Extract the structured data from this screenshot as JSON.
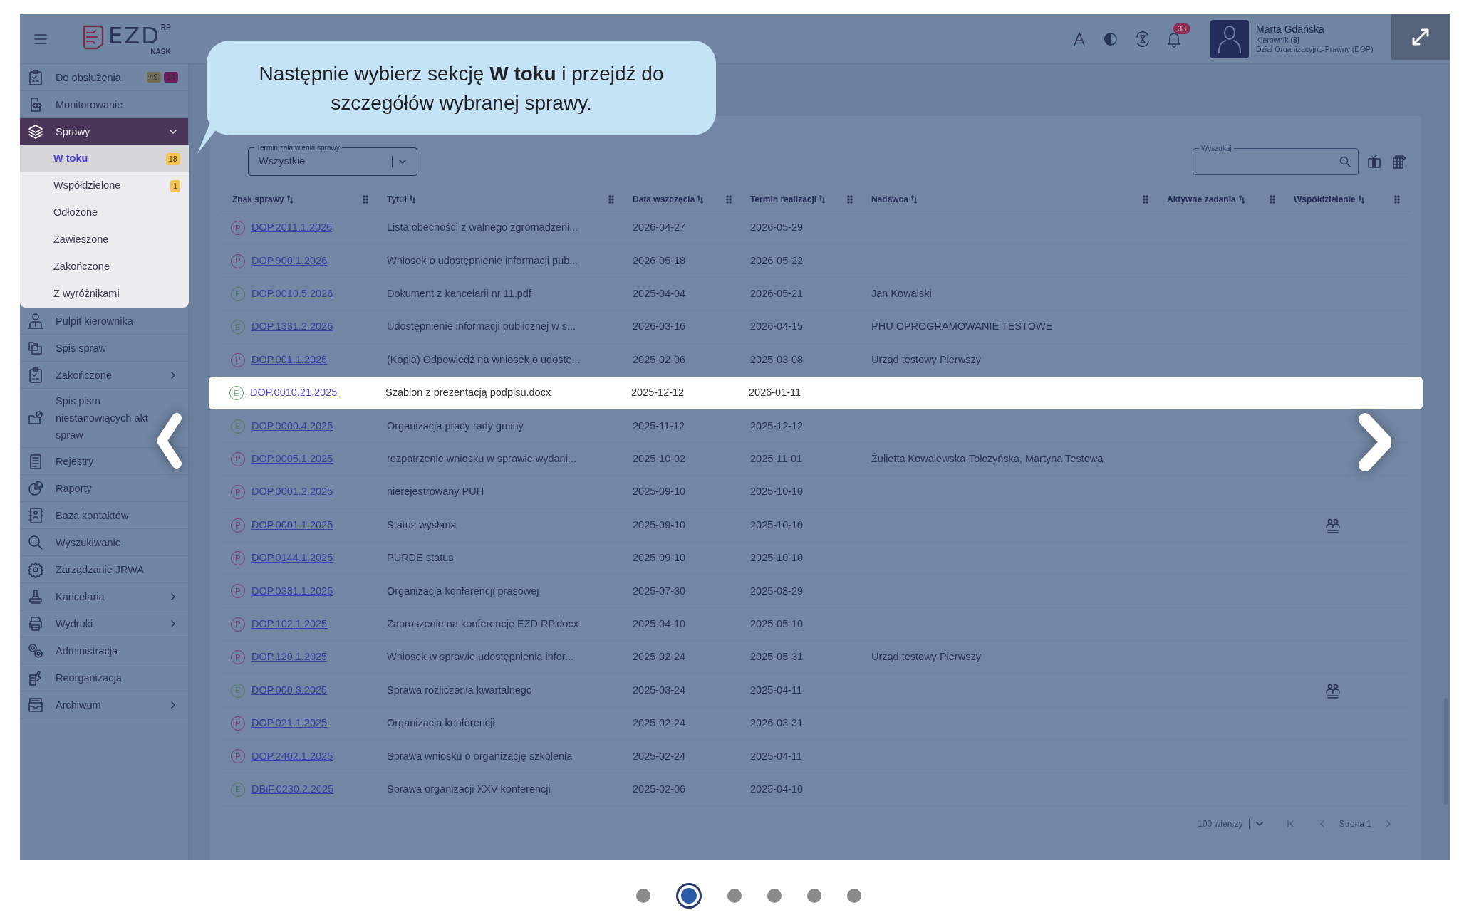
{
  "header": {
    "logo": {
      "text": "EZD",
      "sup": "RP",
      "sub": "NASK"
    },
    "notification_count": "33",
    "user": {
      "name": "Marta Gdańska",
      "role": "Kierownik",
      "role_count": "(3)",
      "department": "Dział Organizacyjno-Prawny (DOP)"
    }
  },
  "sidebar": {
    "items": [
      {
        "label": "Do obsłużenia",
        "badges": [
          {
            "text": "49",
            "color": "#6f6b4f"
          },
          {
            "text": "14",
            "color": "#6b2160"
          }
        ]
      },
      {
        "label": "Monitorowanie"
      },
      {
        "label": "Sprawy",
        "expanded": true,
        "children": [
          {
            "label": "W toku",
            "selected": true,
            "badge": "18"
          },
          {
            "label": "Współdzielone",
            "selected": false,
            "badge": "1"
          },
          {
            "label": "Odłożone",
            "selected": false
          },
          {
            "label": "Zawieszone",
            "selected": false
          },
          {
            "label": "Zakończone",
            "selected": false
          },
          {
            "label": "Z wyróżnikami",
            "selected": false
          }
        ]
      },
      {
        "label": "Pulpit kierownika"
      },
      {
        "label": "Spis spraw"
      },
      {
        "label": "Zakończone",
        "expanded": false
      },
      {
        "label": "Spis pism niestanowiących akt spraw"
      },
      {
        "label": "Rejestry"
      },
      {
        "label": "Raporty"
      },
      {
        "label": "Baza kontaktów"
      },
      {
        "label": "Wyszukiwanie"
      },
      {
        "label": "Zarządzanie JRWA"
      },
      {
        "label": "Kancelaria",
        "expanded": false
      },
      {
        "label": "Wydruki",
        "expanded": false
      },
      {
        "label": "Administracja"
      },
      {
        "label": "Reorganizacja"
      },
      {
        "label": "Archiwum",
        "expanded": false
      }
    ]
  },
  "tutorial": {
    "message": "Następnie wybierz sekcję **W toku** i przejdź do szczegółów wybranej sprawy.",
    "slides": [
      {
        "selected": false
      },
      {
        "selected": true
      },
      {
        "selected": false
      },
      {
        "selected": false
      },
      {
        "selected": false
      },
      {
        "selected": false
      }
    ]
  },
  "filter": {
    "label": "Termin załatwienia sprawy",
    "value": "Wszystkie"
  },
  "search": {
    "label": "Wyszukaj"
  },
  "table": {
    "columns": [
      "Znak sprawy",
      "Tytuł",
      "Data wszczęcia",
      "Termin realizacji",
      "Nadawca",
      "Aktywne zadania",
      "Współdzielenie"
    ],
    "rows": [
      {
        "type": "P",
        "case": "DOP.2011.1.2026",
        "title": "Lista obecności z walnego zgromadzeni...",
        "start": "2026-04-27",
        "due": "2026-05-29",
        "highlighted": false,
        "shared": false
      },
      {
        "type": "P",
        "case": "DOP.900.1.2026",
        "title": "Wniosek o udostępnienie informacji pub...",
        "start": "2026-05-18",
        "due": "2026-05-22",
        "highlighted": false,
        "shared": false
      },
      {
        "type": "E",
        "case": "DOP.0010.5.2026",
        "title": "Dokument z kancelarii nr 11.pdf",
        "start": "2025-04-04",
        "due": "2026-05-21",
        "sender": "Jan Kowalski",
        "highlighted": false,
        "shared": false
      },
      {
        "type": "E",
        "case": "DOP.1331.2.2026",
        "title": "Udostępnienie informacji publicznej w s...",
        "start": "2026-03-16",
        "due": "2026-04-15",
        "sender": "PHU OPROGRAMOWANIE TESTOWE",
        "highlighted": false,
        "shared": false
      },
      {
        "type": "P",
        "case": "DOP.001.1.2026",
        "title": "(Kopia) Odpowiedź na wniosek o udostę...",
        "start": "2025-02-06",
        "due": "2025-03-08",
        "sender": "Urząd testowy Pierwszy",
        "highlighted": false,
        "shared": false
      },
      {
        "type": "E",
        "case": "DOP.0010.21.2025",
        "title": "Szablon z prezentacją podpisu.docx",
        "start": "2025-12-12",
        "due": "2026-01-11",
        "highlighted": true,
        "shared": false
      },
      {
        "type": "E",
        "case": "DOP.0000.4.2025",
        "title": "Organizacja pracy rady gminy",
        "start": "2025-11-12",
        "due": "2025-12-12",
        "highlighted": false,
        "shared": false
      },
      {
        "type": "P",
        "case": "DOP.0005.1.2025",
        "title": "rozpatrzenie wniosku w sprawie wydani...",
        "start": "2025-10-02",
        "due": "2025-11-01",
        "sender": "Żulietta Kowalewska-Tołczyńska, Martyna Testowa",
        "highlighted": false,
        "shared": false
      },
      {
        "type": "P",
        "case": "DOP.0001.2.2025",
        "title": "nierejestrowany PUH",
        "start": "2025-09-10",
        "due": "2025-10-10",
        "highlighted": false,
        "shared": false
      },
      {
        "type": "P",
        "case": "DOP.0001.1.2025",
        "title": "Status wysłana",
        "start": "2025-09-10",
        "due": "2025-10-10",
        "highlighted": false,
        "shared": true
      },
      {
        "type": "P",
        "case": "DOP.0144.1.2025",
        "title": "PURDE status",
        "start": "2025-09-10",
        "due": "2025-10-10",
        "highlighted": false,
        "shared": false
      },
      {
        "type": "P",
        "case": "DOP.0331.1.2025",
        "title": "Organizacja konferencji prasowej",
        "start": "2025-07-30",
        "due": "2025-08-29",
        "highlighted": false,
        "shared": false
      },
      {
        "type": "P",
        "case": "DOP.102.1.2025",
        "title": "Zaproszenie na konferencję EZD RP.docx",
        "start": "2025-04-10",
        "due": "2025-05-10",
        "highlighted": false,
        "shared": false
      },
      {
        "type": "P",
        "case": "DOP.120.1.2025",
        "title": "Wniosek w sprawie udostępnienia infor...",
        "start": "2025-02-24",
        "due": "2025-05-31",
        "sender": "Urząd testowy Pierwszy",
        "highlighted": false,
        "shared": false
      },
      {
        "type": "E",
        "case": "DOP.000.3.2025",
        "title": "Sprawa rozliczenia kwartalnego",
        "start": "2025-03-24",
        "due": "2025-04-11",
        "highlighted": false,
        "shared": true
      },
      {
        "type": "P",
        "case": "DOP.021.1.2025",
        "title": "Organizacja konferencji",
        "start": "2025-02-24",
        "due": "2026-03-31",
        "highlighted": false,
        "shared": false
      },
      {
        "type": "P",
        "case": "DOP.2402.1.2025",
        "title": "Sprawa wniosku o organizację szkolenia",
        "start": "2025-02-24",
        "due": "2025-04-11",
        "highlighted": false,
        "shared": false
      },
      {
        "type": "E",
        "case": "DBiF.0230.2.2025",
        "title": "Sprawa organizacji XXV konferencji",
        "start": "2025-02-06",
        "due": "2025-04-10",
        "highlighted": false,
        "shared": false
      }
    ]
  },
  "pagination": {
    "rows_per_page": "100 wierszy",
    "page": "Strona 1"
  }
}
